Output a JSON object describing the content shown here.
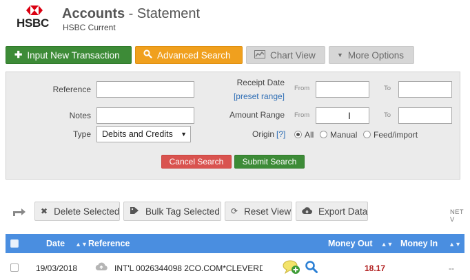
{
  "brand": {
    "logo_text": "HSBC",
    "logo_color": "#db0011"
  },
  "header": {
    "title_bold": "Accounts",
    "title_rest": " - Statement",
    "subtitle": "HSBC Current"
  },
  "toolbar": {
    "input_new": "Input New Transaction",
    "advanced_search": "Advanced Search",
    "chart_view": "Chart View",
    "more_options": "More Options"
  },
  "search": {
    "reference_label": "Reference",
    "notes_label": "Notes",
    "type_label": "Type",
    "type_value": "Debits and Credits",
    "receipt_date_label": "Receipt Date",
    "preset_range": "[preset range]",
    "amount_range_label": "Amount Range",
    "from": "From",
    "to": "To",
    "origin_label": "Origin",
    "origin_help": "[?]",
    "origin_options": [
      "All",
      "Manual",
      "Feed/import"
    ],
    "origin_selected": "All",
    "cancel": "Cancel Search",
    "submit": "Submit Search"
  },
  "actions": {
    "delete": "Delete Selected",
    "bulk_tag": "Bulk Tag Selected",
    "reset": "Reset View",
    "export": "Export Data",
    "net_label": "NET V"
  },
  "table": {
    "columns": [
      "Date",
      "Reference",
      "Money Out",
      "Money In"
    ],
    "rows": [
      {
        "date": "19/03/2018",
        "reference": "INT'L 0026344098 2CO.COM*CLEVERD",
        "money_out": "18.17",
        "money_in": "--"
      }
    ]
  },
  "colors": {
    "accent_blue": "#4a8ee0",
    "green": "#3d8b37",
    "orange": "#f0a01e",
    "red": "#d9534f"
  }
}
